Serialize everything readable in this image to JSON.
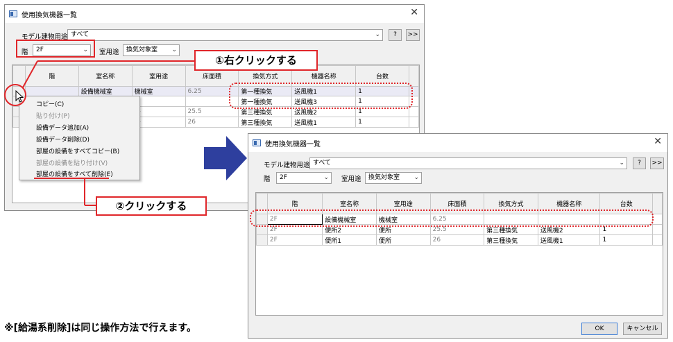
{
  "dialog1": {
    "title": "使用換気機器一覧",
    "model_label": "モデル建物用途",
    "model_value": "すべて",
    "help_button": "?",
    "more_button": ">>",
    "floor_label": "階",
    "floor_value": "2F",
    "room_use_label": "室用途",
    "room_use_value": "換気対象室",
    "columns": [
      "階",
      "室名称",
      "室用途",
      "床面積",
      "換気方式",
      "機器名称",
      "台数"
    ],
    "rows": [
      [
        "",
        "設備機械室",
        "機械室",
        "6.25",
        "第一種換気",
        "送風機1",
        "1"
      ],
      [
        "",
        "",
        "",
        "",
        "第一種換気",
        "送風機3",
        "1"
      ],
      [
        "",
        "",
        "所",
        "25.5",
        "第三種換気",
        "送風機2",
        "1"
      ],
      [
        "",
        "",
        "所",
        "26",
        "第三種換気",
        "送風機1",
        "1"
      ]
    ]
  },
  "context_menu": {
    "items": [
      {
        "label": "コピー(C)",
        "disabled": false
      },
      {
        "label": "貼り付け(P)",
        "disabled": true
      },
      {
        "label": "設備データ追加(A)",
        "disabled": false
      },
      {
        "label": "設備データ削除(D)",
        "disabled": false
      },
      {
        "label": "部屋の設備をすべてコピー(B)",
        "disabled": false
      },
      {
        "label": "部屋の設備を貼り付け(V)",
        "disabled": true
      },
      {
        "label": "部屋の設備をすべて削除(E)",
        "disabled": false
      }
    ]
  },
  "callouts": {
    "step1": "①右クリックする",
    "step2": "②クリックする"
  },
  "dialog2": {
    "title": "使用換気機器一覧",
    "model_label": "モデル建物用途",
    "model_value": "すべて",
    "help_button": "?",
    "more_button": ">>",
    "floor_label": "階",
    "floor_value": "2F",
    "room_use_label": "室用途",
    "room_use_value": "換気対象室",
    "columns": [
      "階",
      "室名称",
      "室用途",
      "床面積",
      "換気方式",
      "機器名称",
      "台数"
    ],
    "rows": [
      [
        "2F",
        "設備機械室",
        "機械室",
        "6.25",
        "",
        "",
        ""
      ],
      [
        "2F",
        "便所2",
        "便所",
        "25.5",
        "第三種換気",
        "送風機2",
        "1"
      ],
      [
        "2F",
        "便所1",
        "便所",
        "26",
        "第三種換気",
        "送風機1",
        "1"
      ]
    ],
    "ok_button": "OK",
    "cancel_button": "キャンセル"
  },
  "footnote": "※[給湯系削除]は同じ操作方法で行えます。",
  "colors": {
    "accent_red": "#e0262a",
    "arrow_blue": "#2e3f9e"
  }
}
